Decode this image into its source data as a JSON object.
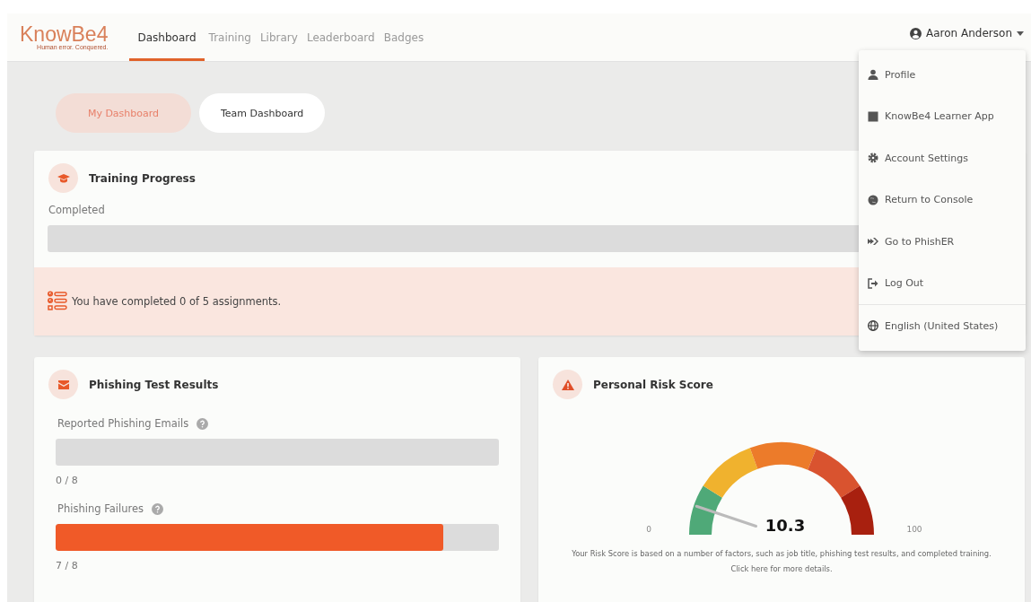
{
  "header": {
    "logo": "KnowBe4",
    "tagline": "Human error. Conquered.",
    "nav": [
      {
        "label": "Dashboard",
        "selected": true
      },
      {
        "label": "Training",
        "selected": false
      },
      {
        "label": "Library",
        "selected": false
      },
      {
        "label": "Leaderboard",
        "selected": false
      },
      {
        "label": "Badges",
        "selected": false
      }
    ],
    "user": {
      "name": "Aaron Anderson",
      "expanded": true
    }
  },
  "user_menu": [
    {
      "kind": "profile",
      "label": "Profile"
    },
    {
      "kind": "app",
      "label": "KnowBe4 Learner App"
    },
    {
      "kind": "settings",
      "label": "Account Settings"
    },
    {
      "kind": "console",
      "label": "Return to Console"
    },
    {
      "kind": "phisher",
      "label": "Go to PhishER"
    },
    {
      "kind": "logout",
      "label": "Log Out"
    },
    {
      "kind": "language",
      "label": "English (United States)"
    }
  ],
  "dashboard_toggle": [
    {
      "label": "My Dashboard",
      "selected": true
    },
    {
      "label": "Team Dashboard",
      "selected": false
    }
  ],
  "training_progress": {
    "title": "Training Progress",
    "label": "Completed",
    "level": 0,
    "message": "You have completed 0 of 5 assignments."
  },
  "phishing_results": {
    "title": "Phishing Test Results",
    "metrics": [
      {
        "label": "Reported Phishing Emails",
        "level": 0,
        "reading": "0 / 8"
      },
      {
        "label": "Phishing Failures",
        "level": 0.875,
        "reading": "7 / 8"
      }
    ]
  },
  "risk_score": {
    "title": "Personal Risk Score",
    "min": "0",
    "max": "100",
    "reading": "10.3",
    "note": "Your Risk Score is based on a number of factors, such as job title, phishing test results, and completed training. Click here for more details."
  }
}
